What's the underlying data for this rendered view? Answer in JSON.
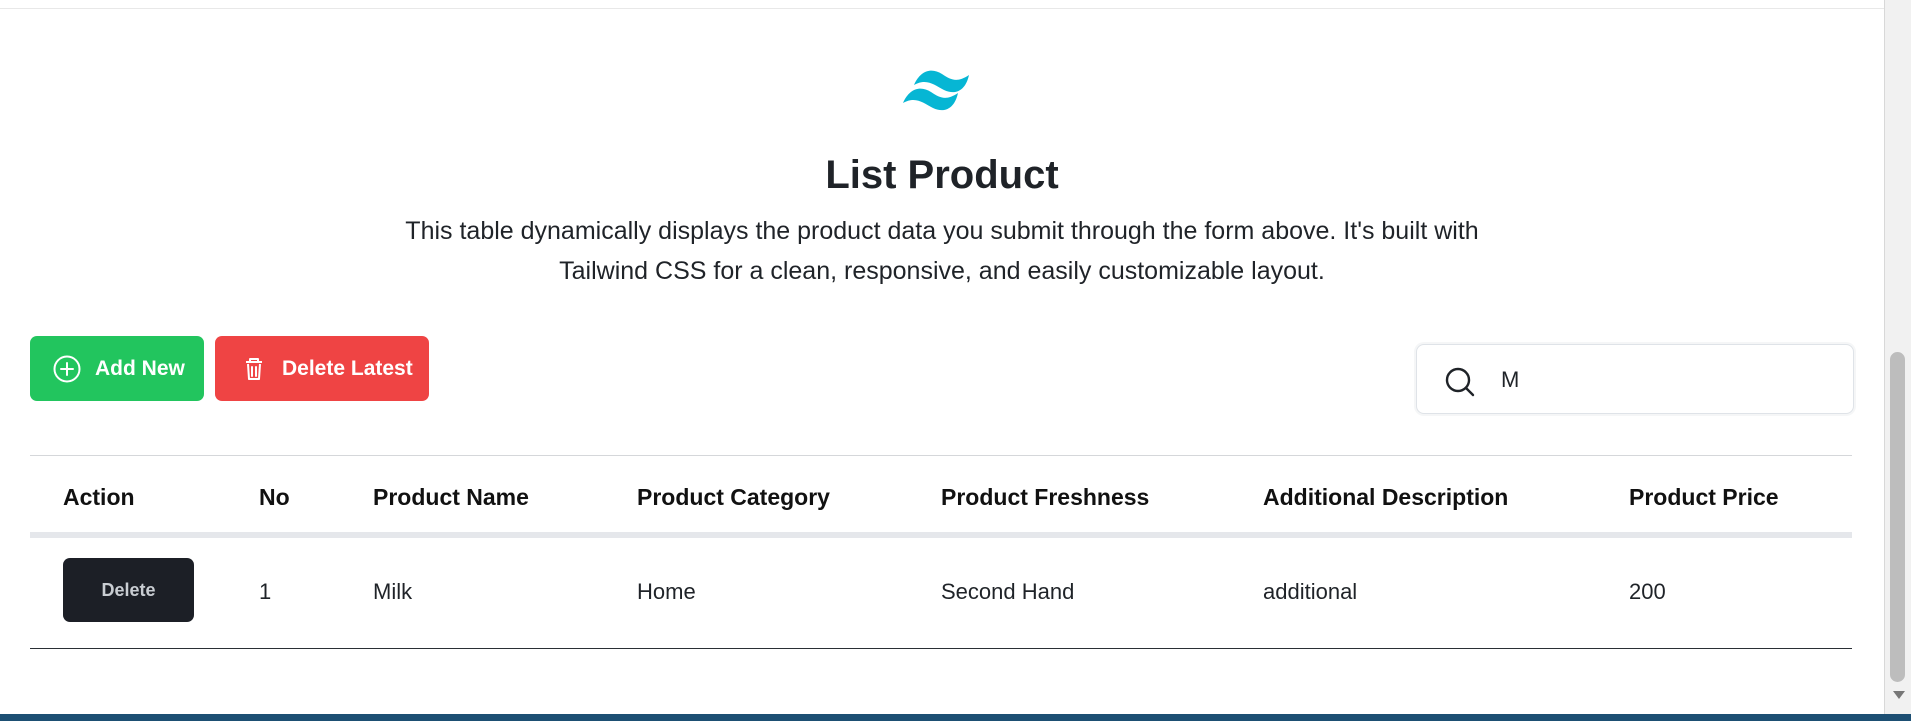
{
  "page": {
    "title": "List Product",
    "description_line_1": "This table dynamically displays the product data you submit through the form above. It's built with",
    "description_line_2": "Tailwind CSS for a clean, responsive, and easily customizable layout."
  },
  "icons": {
    "logo": "tailwind-logo-icon",
    "add": "plus-circle-icon",
    "delete_latest": "trash-icon",
    "search": "search-icon"
  },
  "colors": {
    "logo": "#06b6d4",
    "add_button": "#22c55e",
    "delete_latest_button": "#ef4444",
    "row_delete_button": "#1c1f26"
  },
  "toolbar": {
    "add_label": "Add New",
    "delete_latest_label": "Delete Latest"
  },
  "search": {
    "value": "M"
  },
  "table": {
    "headers": [
      "Action",
      "No",
      "Product Name",
      "Product Category",
      "Product Freshness",
      "Additional Description",
      "Product Price"
    ],
    "rows": [
      {
        "action_label": "Delete",
        "no": "1",
        "product_name": "Milk",
        "product_category": "Home",
        "product_freshness": "Second Hand",
        "additional_description": "additional",
        "product_price": "200"
      }
    ]
  }
}
